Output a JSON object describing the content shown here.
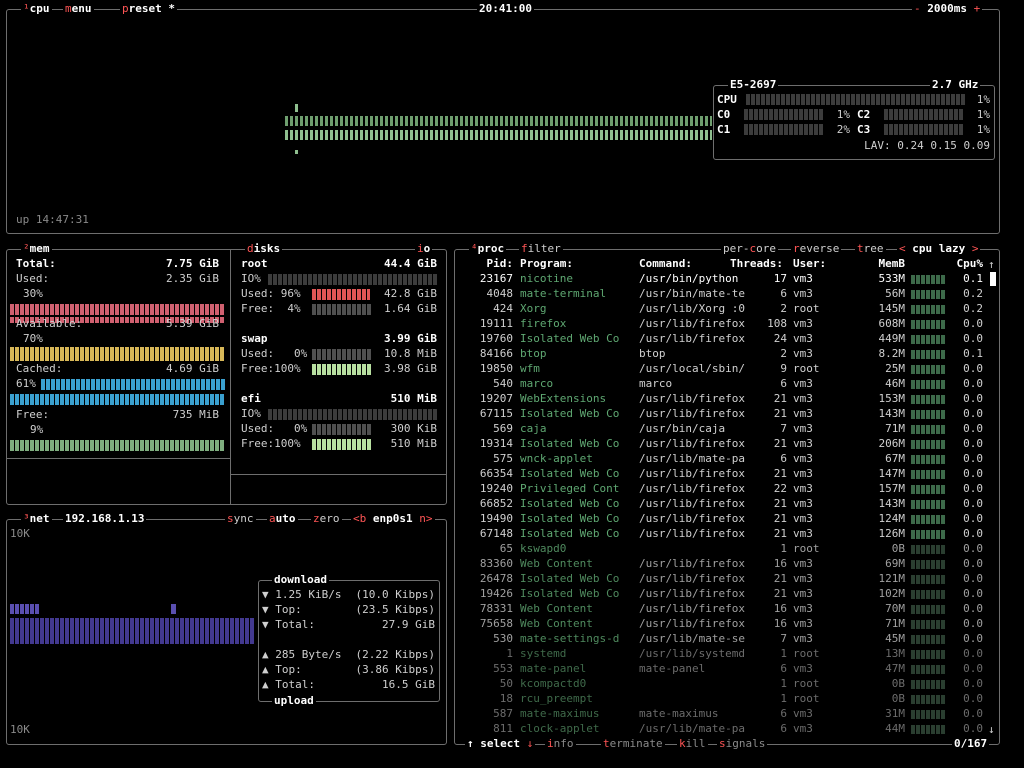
{
  "cpu": {
    "title": "cpu",
    "title_hot": "¹",
    "menu": "menu",
    "preset": "preset *",
    "clock": "20:41:00",
    "interval": "2000ms",
    "interval_minus": "-",
    "interval_plus": "+",
    "uptime": "up 14:47:31",
    "model": "E5-2697",
    "freq": "2.7 GHz",
    "rows": [
      {
        "label": "CPU",
        "pct": "1%"
      },
      {
        "label": "C0",
        "pct": "1%"
      },
      {
        "label": "C1",
        "pct": "2%"
      },
      {
        "label": "C2",
        "pct": "1%"
      },
      {
        "label": "C3",
        "pct": "1%"
      }
    ],
    "lav": "LAV: 0.24 0.15 0.09"
  },
  "mem": {
    "title": "mem",
    "title_hot": "²",
    "disks_title": "disks",
    "io_label": "io",
    "total_label": "Total:",
    "total": "7.75 GiB",
    "used_label": "Used:",
    "used": "2.35 GiB",
    "used_pct": "30%",
    "avail_label": "Available:",
    "avail": "5.39 GiB",
    "avail_pct": "70%",
    "cached_label": "Cached:",
    "cached": "4.69 GiB",
    "cached_pct": "61%",
    "free_label": "Free:",
    "free": "735 MiB",
    "free_pct": "9%",
    "disks": [
      {
        "name": "root",
        "size": "44.4 GiB",
        "io": "IO%",
        "used_label": "Used:",
        "used_pct": "96%",
        "used": "42.8 GiB",
        "free_label": "Free:",
        "free_pct": "4%",
        "free": "1.64 GiB"
      },
      {
        "name": "swap",
        "size": "3.99 GiB",
        "used_label": "Used:",
        "used_pct": "0%",
        "used": "10.8 MiB",
        "free_label": "Free:",
        "free_pct": "100%",
        "free": "3.98 GiB"
      },
      {
        "name": "efi",
        "size": "510 MiB",
        "io": "IO%",
        "used_label": "Used:",
        "used_pct": "0%",
        "used": "300 KiB",
        "free_label": "Free:",
        "free_pct": "100%",
        "free": "510 MiB"
      }
    ]
  },
  "net": {
    "title": "net",
    "title_hot": "³",
    "ip": "192.168.1.13",
    "sync": "sync",
    "auto": "auto",
    "zero": "zero",
    "iface_prev": "<b",
    "iface": "enp0s1",
    "iface_next": "n>",
    "scale_top": "10K",
    "scale_bottom": "10K",
    "download_title": "download",
    "upload_title": "upload",
    "down_rate": "1.25 KiB/s",
    "down_rate_bits": "(10.0 Kibps)",
    "down_top_label": "Top:",
    "down_top": "(23.5 Kibps)",
    "down_total_label": "Total:",
    "down_total": "27.9 GiB",
    "up_rate": "285 Byte/s",
    "up_rate_bits": "(2.22 Kibps)",
    "up_top_label": "Top:",
    "up_top": "(3.86 Kibps)",
    "up_total_label": "Total:",
    "up_total": "16.5 GiB"
  },
  "proc": {
    "title": "proc",
    "title_hot": "⁴",
    "filter": "filter",
    "per_core": "per-core",
    "reverse": "reverse",
    "tree": "tree",
    "sort_prev": "<",
    "sort": "cpu lazy",
    "sort_next": ">",
    "headers": {
      "pid": "Pid:",
      "program": "Program:",
      "command": "Command:",
      "threads": "Threads:",
      "user": "User:",
      "memb": "MemB",
      "cpu": "Cpu%"
    },
    "select": "select",
    "info": "info",
    "terminate": "terminate",
    "kill": "kill",
    "signals": "signals",
    "count": "0/167",
    "rows": [
      [
        "23167",
        "nicotine",
        "/usr/bin/python",
        "17",
        "vm3",
        "533M",
        "0.1"
      ],
      [
        "4048",
        "mate-terminal",
        "/usr/bin/mate-te",
        "6",
        "vm3",
        "56M",
        "0.2"
      ],
      [
        "424",
        "Xorg",
        "/usr/lib/Xorg :0",
        "2",
        "root",
        "145M",
        "0.2"
      ],
      [
        "19111",
        "firefox",
        "/usr/lib/firefox",
        "108",
        "vm3",
        "608M",
        "0.0"
      ],
      [
        "19760",
        "Isolated Web Co",
        "/usr/lib/firefox",
        "24",
        "vm3",
        "449M",
        "0.0"
      ],
      [
        "84166",
        "btop",
        "btop",
        "2",
        "vm3",
        "8.2M",
        "0.1"
      ],
      [
        "19850",
        "wfm",
        "/usr/local/sbin/",
        "9",
        "root",
        "25M",
        "0.0"
      ],
      [
        "540",
        "marco",
        "marco",
        "6",
        "vm3",
        "46M",
        "0.0"
      ],
      [
        "19207",
        "WebExtensions",
        "/usr/lib/firefox",
        "21",
        "vm3",
        "153M",
        "0.0"
      ],
      [
        "67115",
        "Isolated Web Co",
        "/usr/lib/firefox",
        "21",
        "vm3",
        "143M",
        "0.0"
      ],
      [
        "569",
        "caja",
        "/usr/bin/caja",
        "7",
        "vm3",
        "71M",
        "0.0"
      ],
      [
        "19314",
        "Isolated Web Co",
        "/usr/lib/firefox",
        "21",
        "vm3",
        "206M",
        "0.0"
      ],
      [
        "575",
        "wnck-applet",
        "/usr/lib/mate-pa",
        "6",
        "vm3",
        "67M",
        "0.0"
      ],
      [
        "66354",
        "Isolated Web Co",
        "/usr/lib/firefox",
        "21",
        "vm3",
        "147M",
        "0.0"
      ],
      [
        "19240",
        "Privileged Cont",
        "/usr/lib/firefox",
        "22",
        "vm3",
        "157M",
        "0.0"
      ],
      [
        "66852",
        "Isolated Web Co",
        "/usr/lib/firefox",
        "21",
        "vm3",
        "143M",
        "0.0"
      ],
      [
        "19490",
        "Isolated Web Co",
        "/usr/lib/firefox",
        "21",
        "vm3",
        "124M",
        "0.0"
      ],
      [
        "67148",
        "Isolated Web Co",
        "/usr/lib/firefox",
        "21",
        "vm3",
        "126M",
        "0.0"
      ],
      [
        "65",
        "kswapd0",
        "",
        "1",
        "root",
        "0B",
        "0.0"
      ],
      [
        "83360",
        "Web Content",
        "/usr/lib/firefox",
        "16",
        "vm3",
        "69M",
        "0.0"
      ],
      [
        "26478",
        "Isolated Web Co",
        "/usr/lib/firefox",
        "21",
        "vm3",
        "121M",
        "0.0"
      ],
      [
        "19426",
        "Isolated Web Co",
        "/usr/lib/firefox",
        "21",
        "vm3",
        "102M",
        "0.0"
      ],
      [
        "78331",
        "Web Content",
        "/usr/lib/firefox",
        "16",
        "vm3",
        "70M",
        "0.0"
      ],
      [
        "75658",
        "Web Content",
        "/usr/lib/firefox",
        "16",
        "vm3",
        "71M",
        "0.0"
      ],
      [
        "530",
        "mate-settings-d",
        "/usr/lib/mate-se",
        "7",
        "vm3",
        "45M",
        "0.0"
      ],
      [
        "1",
        "systemd",
        "/usr/lib/systemd",
        "1",
        "root",
        "13M",
        "0.0"
      ],
      [
        "553",
        "mate-panel",
        "mate-panel",
        "6",
        "vm3",
        "47M",
        "0.0"
      ],
      [
        "50",
        "kcompactd0",
        "",
        "1",
        "root",
        "0B",
        "0.0"
      ],
      [
        "18",
        "rcu_preempt",
        "",
        "1",
        "root",
        "0B",
        "0.0"
      ],
      [
        "587",
        "mate-maximus",
        "mate-maximus",
        "6",
        "vm3",
        "31M",
        "0.0"
      ],
      [
        "811",
        "clock-applet",
        "/usr/lib/mate-pa",
        "6",
        "vm3",
        "44M",
        "0.0"
      ]
    ]
  },
  "colors": {
    "hot": "#ff5555",
    "border": "#6e6e6e",
    "cpu_graph": "#8fbf8f",
    "used": "#e0607a",
    "avail": "#e0c060",
    "cached": "#40a8d8",
    "free": "#8fbf8f",
    "net_up": "#5a4fb0",
    "selected_row": "#ffffff"
  }
}
